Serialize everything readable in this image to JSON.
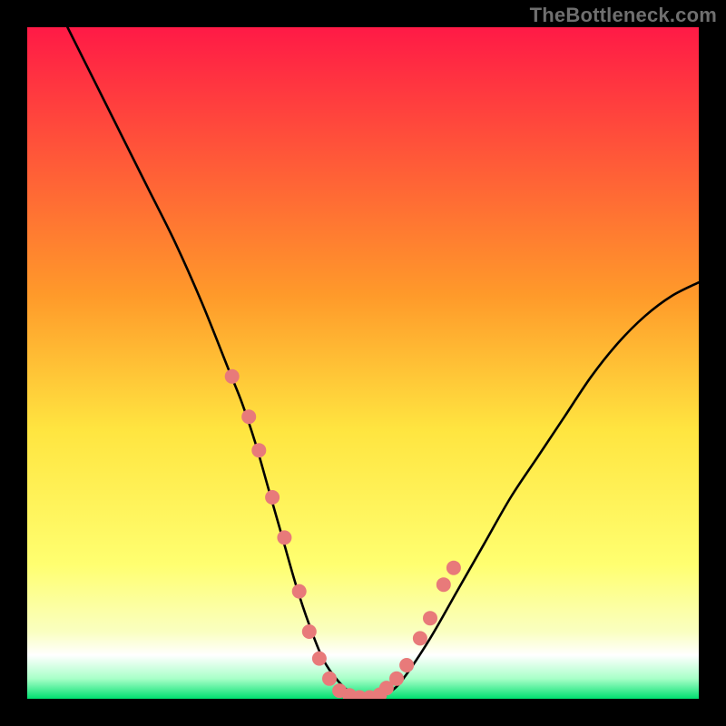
{
  "watermark": "TheBottleneck.com",
  "chart_data": {
    "type": "line",
    "title": "",
    "xlabel": "",
    "ylabel": "",
    "xlim": [
      0,
      100
    ],
    "ylim": [
      0,
      100
    ],
    "grid": false,
    "background_gradient": [
      {
        "pos": 0.0,
        "color": "#ff1a46"
      },
      {
        "pos": 0.4,
        "color": "#ff9a2a"
      },
      {
        "pos": 0.6,
        "color": "#ffe540"
      },
      {
        "pos": 0.8,
        "color": "#ffff70"
      },
      {
        "pos": 0.9,
        "color": "#faffc0"
      },
      {
        "pos": 0.935,
        "color": "#ffffff"
      },
      {
        "pos": 0.97,
        "color": "#a8ffc8"
      },
      {
        "pos": 1.0,
        "color": "#00e070"
      }
    ],
    "series": [
      {
        "name": "bottleneck-curve",
        "stroke": "#000000",
        "x": [
          6,
          10,
          14,
          18,
          22,
          26,
          30,
          32,
          34,
          36,
          38,
          40,
          42,
          44,
          46,
          48,
          50,
          52,
          54,
          56,
          60,
          64,
          68,
          72,
          76,
          80,
          84,
          88,
          92,
          96,
          100
        ],
        "y": [
          100,
          92,
          84,
          76,
          68,
          59,
          49,
          44,
          38,
          31,
          24,
          17,
          11,
          6,
          3,
          1,
          0,
          0,
          1,
          3,
          9,
          16,
          23,
          30,
          36,
          42,
          48,
          53,
          57,
          60,
          62
        ]
      }
    ],
    "points": {
      "name": "highlight-dots",
      "color": "#e87a7a",
      "radius_px": 8,
      "x": [
        30.5,
        33,
        34.5,
        36.5,
        38.3,
        40.5,
        42,
        43.5,
        45,
        46.5,
        48,
        49.5,
        51,
        52.5,
        53.5,
        55,
        56.5,
        58.5,
        60,
        62,
        63.5
      ],
      "y": [
        48,
        42,
        37,
        30,
        24,
        16,
        10,
        6,
        3,
        1.2,
        0.5,
        0.2,
        0.2,
        0.6,
        1.6,
        3,
        5,
        9,
        12,
        17,
        19.5
      ]
    }
  }
}
